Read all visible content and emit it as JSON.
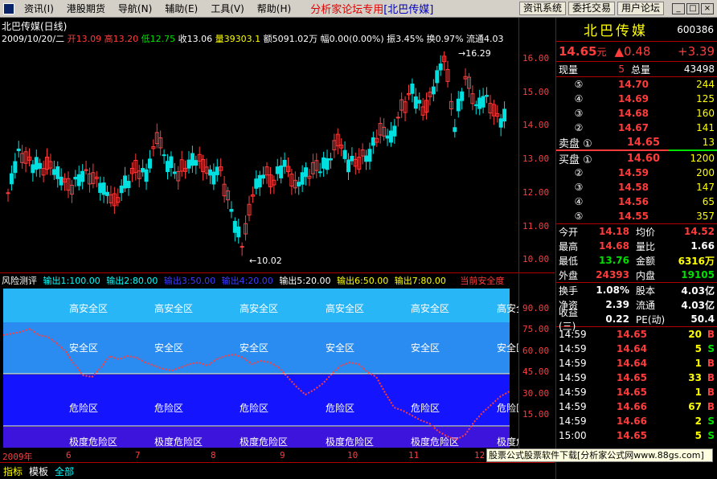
{
  "menu": {
    "items": [
      "资讯(I)",
      "港股期货",
      "导航(N)",
      "辅助(E)",
      "工具(V)",
      "帮助(H)"
    ],
    "brand": "分析家论坛专用",
    "brand_stock": "[北巴传媒]",
    "buttons": [
      "资讯系统",
      "委托交易",
      "用户论坛"
    ],
    "win": [
      "_",
      "□",
      "×"
    ]
  },
  "chart": {
    "title": "北巴传媒(日线)",
    "date": "2009/10/20/二",
    "open_label": "开",
    "open": "13.09",
    "high_label": "高",
    "high": "13.20",
    "low_label": "低",
    "low": "12.75",
    "close_label": "收",
    "close": "13.06",
    "vol_label": "量",
    "vol": "39303.1",
    "amt_label": "额",
    "amt": "5091.02万",
    "amp_label": "幅",
    "amp": "0.00(0.00%)",
    "swing_label": "振",
    "swing": "3.45%",
    "turn_label": "换",
    "turn": "0.97%",
    "float_label": "流通",
    "float": "4.03",
    "high_mark": "16.29",
    "low_mark": "10.02",
    "y_ticks": [
      "16.00",
      "15.00",
      "14.00",
      "13.00",
      "12.00",
      "11.00",
      "10.00"
    ],
    "ind_y_ticks": [
      "90.00",
      "75.00",
      "60.00",
      "45.00",
      "30.00",
      "15.00"
    ],
    "x_ticks": [
      "2009年",
      "6",
      "7",
      "8",
      "9",
      "10",
      "11",
      "12"
    ]
  },
  "indicator": {
    "name": "风险测评",
    "outputs": [
      {
        "label": "输出1:100.00",
        "color": "#00ffff"
      },
      {
        "label": "输出2:80.00",
        "color": "#00ffff"
      },
      {
        "label": "输出3:50.00",
        "color": "#3c3cff"
      },
      {
        "label": "输出4:20.00",
        "color": "#3c3cff"
      },
      {
        "label": "输出5:20.00",
        "color": "#ffffff"
      },
      {
        "label": "输出6:50.00",
        "color": "#ffff00"
      },
      {
        "label": "输出7:80.00",
        "color": "#ffff00"
      }
    ],
    "current": "当前安全度",
    "zones": [
      "高安全区",
      "安全区",
      "危险区",
      "极度危险区"
    ]
  },
  "panel": {
    "name": "北巴传媒",
    "code": "600386",
    "price": "14.65",
    "price_unit": "元",
    "change": "▲0.48",
    "change_pct": "+3.39",
    "now_vol_label": "现量",
    "now_vol": "5",
    "total_vol_label": "总量",
    "total_vol": "43498",
    "sells": [
      {
        "lvl": "⑤",
        "price": "14.70",
        "vol": "244"
      },
      {
        "lvl": "④",
        "price": "14.69",
        "vol": "125"
      },
      {
        "lvl": "③",
        "price": "14.68",
        "vol": "160"
      },
      {
        "lvl": "②",
        "price": "14.67",
        "vol": "141"
      }
    ],
    "sell1_label": "卖盘 ①",
    "sell1_price": "14.65",
    "sell1_vol": "13",
    "buy1_label": "买盘 ①",
    "buy1_price": "14.60",
    "buy1_vol": "1200",
    "buys": [
      {
        "lvl": "②",
        "price": "14.59",
        "vol": "200"
      },
      {
        "lvl": "③",
        "price": "14.58",
        "vol": "147"
      },
      {
        "lvl": "④",
        "price": "14.56",
        "vol": "65"
      },
      {
        "lvl": "⑤",
        "price": "14.55",
        "vol": "357"
      }
    ],
    "stats": [
      {
        "l1": "今开",
        "v1": "14.18",
        "l2": "均价",
        "v2": "14.52",
        "c1": "#ff3c3c",
        "c2": "#ff3c3c"
      },
      {
        "l1": "最高",
        "v1": "14.68",
        "l2": "量比",
        "v2": "1.66",
        "c1": "#ff3c3c",
        "c2": "#ffffff"
      },
      {
        "l1": "最低",
        "v1": "13.76",
        "l2": "金额",
        "v2": "6316万",
        "c1": "#00e000",
        "c2": "#ffff00"
      },
      {
        "l1": "外盘",
        "v1": "24393",
        "l2": "内盘",
        "v2": "19105",
        "c1": "#ff3c3c",
        "c2": "#00e000"
      }
    ],
    "stats2": [
      {
        "l1": "换手",
        "v1": "1.08%",
        "l2": "股本",
        "v2": "4.03亿"
      },
      {
        "l1": "净资",
        "v1": "2.39",
        "l2": "流通",
        "v2": "4.03亿"
      },
      {
        "l1": "收益(三)",
        "v1": "0.22",
        "l2": "PE(动)",
        "v2": "50.4"
      }
    ],
    "ticks": [
      {
        "t": "14:59",
        "p": "14.65",
        "v": "20",
        "d": "B"
      },
      {
        "t": "14:59",
        "p": "14.64",
        "v": "5",
        "d": "S"
      },
      {
        "t": "14:59",
        "p": "14.64",
        "v": "1",
        "d": "B"
      },
      {
        "t": "14:59",
        "p": "14.65",
        "v": "33",
        "d": "B"
      },
      {
        "t": "14:59",
        "p": "14.65",
        "v": "1",
        "d": "B"
      },
      {
        "t": "14:59",
        "p": "14.66",
        "v": "67",
        "d": "B"
      },
      {
        "t": "14:59",
        "p": "14.66",
        "v": "2",
        "d": "S"
      },
      {
        "t": "15:00",
        "p": "14.65",
        "v": "5",
        "d": "S"
      }
    ]
  },
  "bottom": {
    "tabs": [
      "指标",
      "模板",
      "全部"
    ]
  },
  "ad": "股票公式股票软件下载[分析家公式网www.88gs.com]",
  "colors": {
    "up": "#ff3c3c",
    "down": "#00e0e0",
    "grid": "#b00000"
  }
}
